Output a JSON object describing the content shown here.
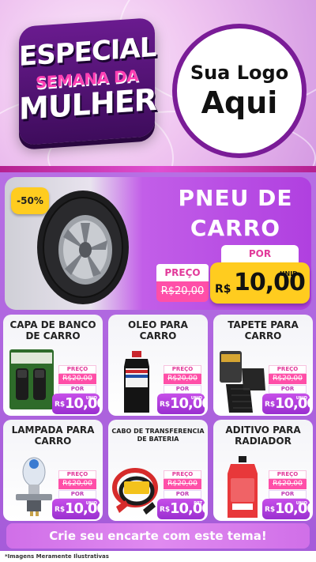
{
  "header": {
    "badge_line1": "ESPECIAL",
    "badge_line2": "SEMANA DA",
    "badge_line3": "MULHER",
    "logo_line1": "Sua Logo",
    "logo_line2": "Aqui"
  },
  "featured": {
    "discount": "-50%",
    "title_line1": "PNEU DE",
    "title_line2": "CARRO",
    "preco_label": "PREÇO",
    "old_price": "R$20,00",
    "por_label": "POR",
    "currency": "R$",
    "price": "10,00",
    "unit": "UNID"
  },
  "products": [
    {
      "title_line1": "CAPA DE BANCO",
      "title_line2": "DE CARRO",
      "preco_label": "PREÇO",
      "old_price": "R$20,00",
      "por_label": "POR",
      "currency": "R$",
      "price": "10,00",
      "unit": "UNID"
    },
    {
      "title_line1": "OLEO PARA",
      "title_line2": "CARRO",
      "preco_label": "PREÇO",
      "old_price": "R$20,00",
      "por_label": "POR",
      "currency": "R$",
      "price": "10,00",
      "unit": "UNID"
    },
    {
      "title_line1": "TAPETE PARA",
      "title_line2": "CARRO",
      "preco_label": "PREÇO",
      "old_price": "R$20,00",
      "por_label": "POR",
      "currency": "R$",
      "price": "10,00",
      "unit": "UNID"
    },
    {
      "title_line1": "LAMPADA PARA",
      "title_line2": "CARRO",
      "preco_label": "PREÇO",
      "old_price": "R$20,00",
      "por_label": "POR",
      "currency": "R$",
      "price": "10,00",
      "unit": "UNID"
    },
    {
      "title_line1": "CABO DE TRANSFERENCIA",
      "title_line2": "DE BATERIA",
      "preco_label": "PREÇO",
      "old_price": "R$20,00",
      "por_label": "POR",
      "currency": "R$",
      "price": "10,00",
      "unit": "PRT"
    },
    {
      "title_line1": "ADITIVO PARA",
      "title_line2": "RADIADOR",
      "preco_label": "PREÇO",
      "old_price": "R$20,00",
      "por_label": "POR",
      "currency": "R$",
      "price": "10,00",
      "unit": "UNID"
    }
  ],
  "footer": {
    "cta": "Crie seu encarte com este tema!",
    "disclaimer": "*Imagens Meramente Ilustrativas"
  },
  "colors": {
    "purple_dark": "#5a167c",
    "pink": "#ff4fa8",
    "yellow": "#ffcc1f",
    "purple_bg": "#b76fe4"
  }
}
